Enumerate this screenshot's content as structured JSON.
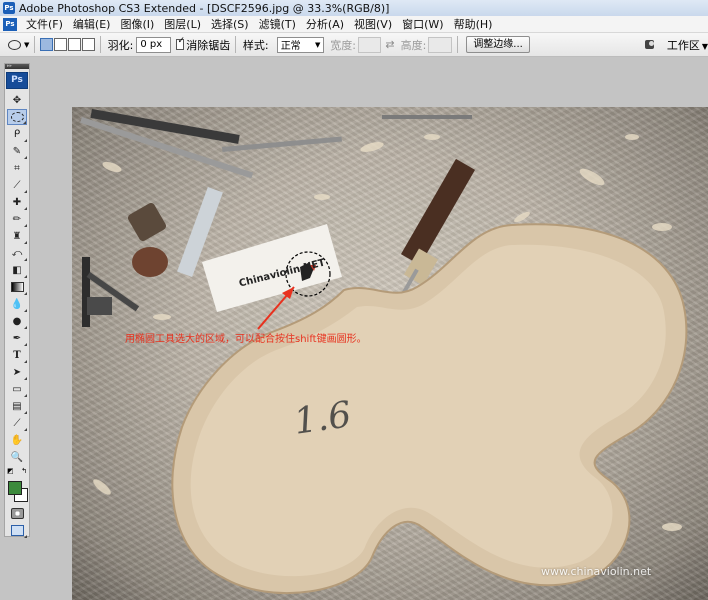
{
  "window": {
    "title": "Adobe Photoshop CS3 Extended - [DSCF2596.jpg @ 33.3%(RGB/8)]",
    "app_icon": "photoshop-icon"
  },
  "menubar": {
    "items": [
      "文件(F)",
      "编辑(E)",
      "图像(I)",
      "图层(L)",
      "选择(S)",
      "滤镜(T)",
      "分析(A)",
      "视图(V)",
      "窗口(W)",
      "帮助(H)"
    ]
  },
  "options": {
    "feather_label": "羽化:",
    "feather_value": "0 px",
    "antialias_label": "消除锯齿",
    "antialias_checked": true,
    "style_label": "样式:",
    "style_value": "正常",
    "width_label": "宽度:",
    "height_label": "高度:",
    "refine_edge_button": "调整边缘...",
    "workspace_label": "工作区"
  },
  "toolbox": {
    "logo": "Ps",
    "tools": [
      "move-icon",
      "elliptical-marquee-icon",
      "lasso-icon",
      "quick-selection-icon",
      "crop-icon",
      "eyedropper-icon",
      "spot-healing-icon",
      "brush-icon",
      "clone-stamp-icon",
      "history-brush-icon",
      "eraser-icon",
      "gradient-icon",
      "blur-icon",
      "dodge-icon",
      "pen-icon",
      "type-icon",
      "path-selection-icon",
      "rectangle-shape-icon",
      "notes-icon",
      "eyedropper-icon",
      "hand-icon",
      "zoom-icon"
    ],
    "foreground_color": "#3c8a3c",
    "background_color": "#ffffff"
  },
  "document": {
    "annotation": "用椭圆工具选大的区域，可以配合按住shift键画圆形。",
    "card_text": "Chinaviolin.NET",
    "pencil_mark": "1.6",
    "watermark": "www.chinaviolin.net"
  },
  "colors": {
    "accent": "#1b5fb8",
    "annotation_red": "#e8311e"
  }
}
